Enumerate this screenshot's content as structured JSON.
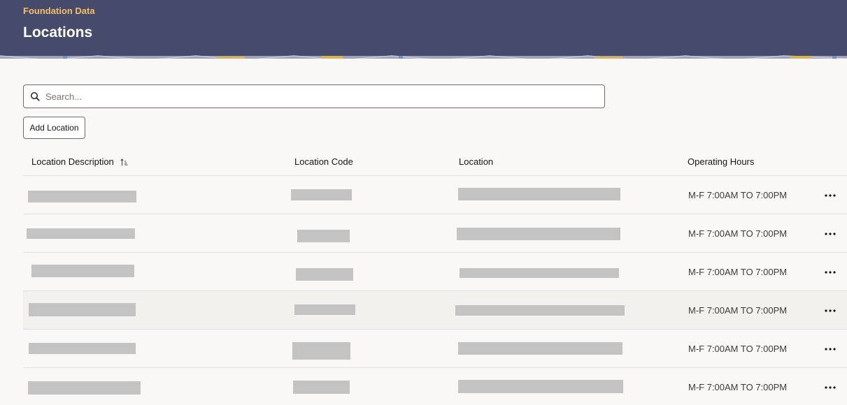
{
  "header": {
    "breadcrumb": "Foundation Data",
    "title": "Locations",
    "bg_color": "#474b6b",
    "breadcrumb_color": "#f5c063"
  },
  "search": {
    "placeholder": "Search...",
    "value": "",
    "icon": "search-icon"
  },
  "toolbar": {
    "add_label": "Add Location"
  },
  "table": {
    "columns": [
      "Location Description",
      "Location Code",
      "Location",
      "Operating Hours"
    ],
    "sort_icon": "sort-ascending-icon",
    "row_action_icon": "more-horizontal-icon",
    "rows": [
      {
        "description": "",
        "code": "",
        "location": "",
        "hours": "M-F 7:00AM TO 7:00PM"
      },
      {
        "description": "",
        "code": "",
        "location": "",
        "hours": "M-F 7:00AM TO 7:00PM"
      },
      {
        "description": "",
        "code": "",
        "location": "",
        "hours": "M-F 7:00AM TO 7:00PM"
      },
      {
        "description": "",
        "code": "",
        "location": "",
        "hours": "M-F 7:00AM TO 7:00PM"
      },
      {
        "description": "",
        "code": "",
        "location": "",
        "hours": "M-F 7:00AM TO 7:00PM"
      },
      {
        "description": "",
        "code": "",
        "location": "",
        "hours": "M-F 7:00AM TO 7:00PM"
      }
    ]
  }
}
